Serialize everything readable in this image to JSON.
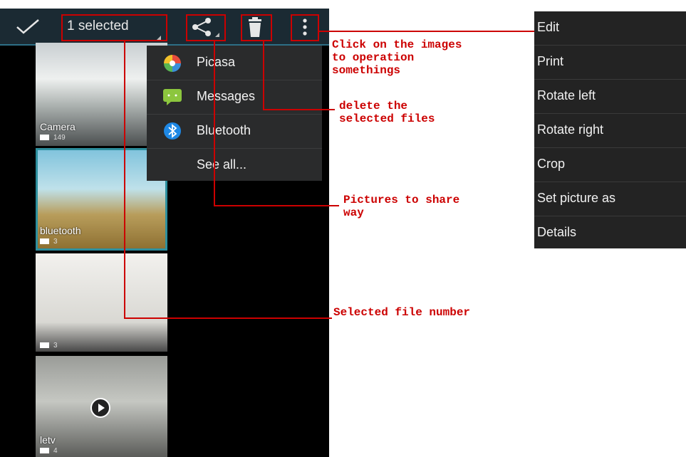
{
  "actionbar": {
    "selected_label": "1 selected"
  },
  "share_menu": {
    "items": [
      {
        "label": "Picasa",
        "icon": "picasa-icon"
      },
      {
        "label": "Messages",
        "icon": "messages-icon"
      },
      {
        "label": "Bluetooth",
        "icon": "bluetooth-icon"
      },
      {
        "label": "See all...",
        "icon": ""
      }
    ]
  },
  "albums": [
    {
      "name": "Camera",
      "count": "149"
    },
    {
      "name": "bluetooth",
      "count": "3"
    },
    {
      "name": "",
      "count": "3"
    },
    {
      "name": "letv",
      "count": "4"
    }
  ],
  "overflow_menu": {
    "items": [
      "Edit",
      "Print",
      "Rotate left",
      "Rotate right",
      "Crop",
      "Set picture as",
      "Details"
    ]
  },
  "annotations": {
    "overflow": [
      "Click on the images",
      "to operation",
      "somethings"
    ],
    "delete": [
      "delete the",
      "selected files"
    ],
    "share": [
      "Pictures to share",
      "way"
    ],
    "selected": [
      "Selected file number"
    ]
  },
  "colors": {
    "annotation_red": "#cc0000",
    "actionbar": "#1b2a33",
    "accent_teal": "#2d8f9e"
  }
}
